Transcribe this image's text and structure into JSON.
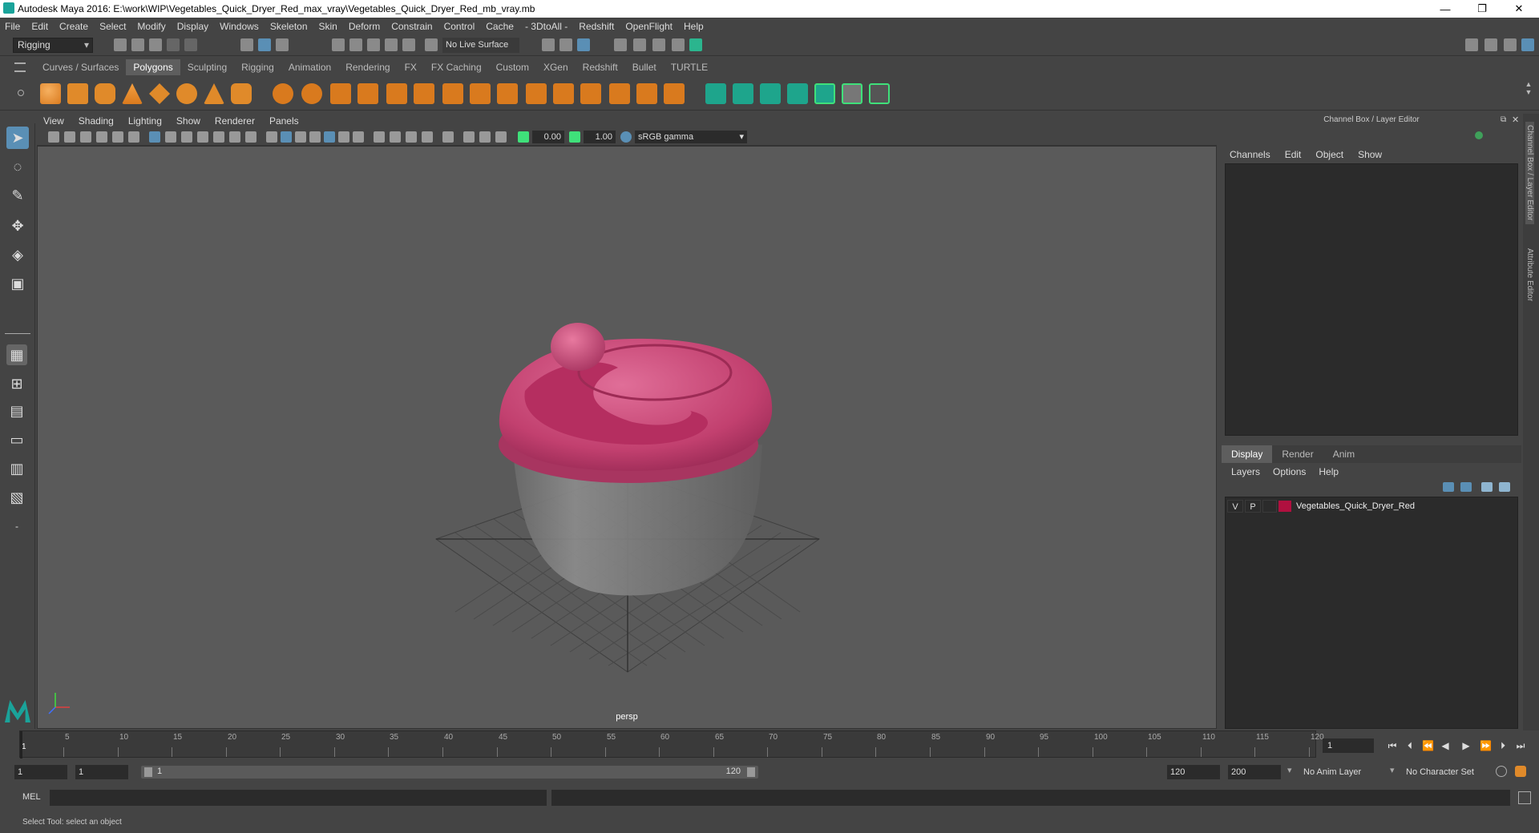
{
  "window": {
    "title": "Autodesk Maya 2016: E:\\work\\WIP\\Vegetables_Quick_Dryer_Red_max_vray\\Vegetables_Quick_Dryer_Red_mb_vray.mb",
    "minimize": "—",
    "maximize": "❐",
    "close": "✕"
  },
  "menubar": [
    "File",
    "Edit",
    "Create",
    "Select",
    "Modify",
    "Display",
    "Windows",
    "Skeleton",
    "Skin",
    "Deform",
    "Constrain",
    "Control",
    "Cache",
    "- 3DtoAll -",
    "Redshift",
    "OpenFlight",
    "Help"
  ],
  "statusline": {
    "menuset": "Rigging",
    "live_surface": "No Live Surface"
  },
  "shelf": {
    "tabs": [
      "Curves / Surfaces",
      "Polygons",
      "Sculpting",
      "Rigging",
      "Animation",
      "Rendering",
      "FX",
      "FX Caching",
      "Custom",
      "XGen",
      "Redshift",
      "Bullet",
      "TURTLE"
    ],
    "active_tab": "Polygons"
  },
  "viewport": {
    "menu": [
      "View",
      "Shading",
      "Lighting",
      "Show",
      "Renderer",
      "Panels"
    ],
    "exposure": "0.00",
    "gamma": "1.00",
    "color_space": "sRGB gamma",
    "camera_label": "persp"
  },
  "channel_box": {
    "header": "Channel Box / Layer Editor",
    "menu": [
      "Channels",
      "Edit",
      "Object",
      "Show"
    ]
  },
  "layer_editor": {
    "tabs": [
      "Display",
      "Render",
      "Anim"
    ],
    "active_tab": "Display",
    "menu": [
      "Layers",
      "Options",
      "Help"
    ],
    "layers": [
      {
        "v": "V",
        "p": "P",
        "color": "#b0103f",
        "name": "Vegetables_Quick_Dryer_Red"
      }
    ]
  },
  "side_tabs": [
    "Channel Box / Layer Editor",
    "Attribute Editor"
  ],
  "timeline": {
    "ticks": [
      "5",
      "10",
      "15",
      "20",
      "25",
      "30",
      "35",
      "40",
      "45",
      "50",
      "55",
      "60",
      "65",
      "70",
      "75",
      "80",
      "85",
      "90",
      "95",
      "100",
      "105",
      "110",
      "115",
      "120"
    ],
    "start_marker": "1",
    "current_frame": "1"
  },
  "range": {
    "start": "1",
    "playback_start": "1",
    "slider_start": "1",
    "slider_end": "120",
    "playback_end": "120",
    "end": "200",
    "anim_layer": "No Anim Layer",
    "character_set": "No Character Set"
  },
  "command": {
    "label": "MEL"
  },
  "help_line": "Select Tool: select an object"
}
